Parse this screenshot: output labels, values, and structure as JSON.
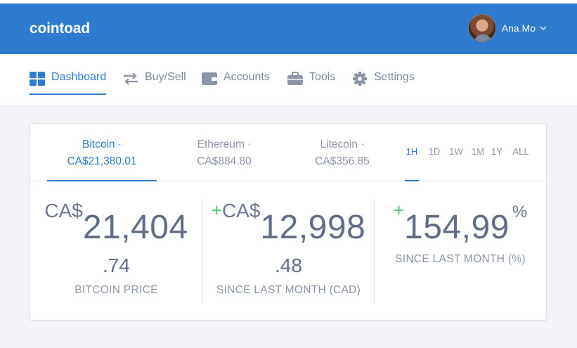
{
  "app": {
    "logo": "cointoad"
  },
  "user": {
    "name": "Ana Mo"
  },
  "nav": {
    "items": [
      {
        "label": "Dashboard",
        "icon": "dashboard-grid-icon",
        "active": true
      },
      {
        "label": "Buy/Sell",
        "icon": "swap-arrows-icon"
      },
      {
        "label": "Accounts",
        "icon": "wallet-icon"
      },
      {
        "label": "Tools",
        "icon": "briefcase-icon"
      },
      {
        "label": "Settings",
        "icon": "gear-icon"
      }
    ]
  },
  "coins": [
    {
      "name": "Bitcoin ·",
      "price": "CA$21,380.01",
      "active": true
    },
    {
      "name": "Ethereum ·",
      "price": "CA$884.80"
    },
    {
      "name": "Litecoin ·",
      "price": "CA$356.85"
    }
  ],
  "ranges": [
    "1H",
    "1D",
    "1W",
    "1M",
    "1Y",
    "ALL"
  ],
  "active_range": "1H",
  "stats": {
    "price": {
      "currency": "CA$",
      "integer": "21,404",
      "decimal": ".74",
      "label": "BITCOIN PRICE"
    },
    "change_cad": {
      "sign": "+",
      "currency": "CA$",
      "integer": "12,998",
      "decimal": ".48",
      "label": "SINCE LAST MONTH (CAD)"
    },
    "change_pct": {
      "sign": "+",
      "value": "154,99",
      "unit": "%",
      "label": "SINCE LAST MONTH (%)"
    }
  },
  "colors": {
    "brand": "#2f7bcf",
    "positive": "#53c37a",
    "text_muted": "#8a96a8",
    "text_value": "#5f6d86"
  }
}
